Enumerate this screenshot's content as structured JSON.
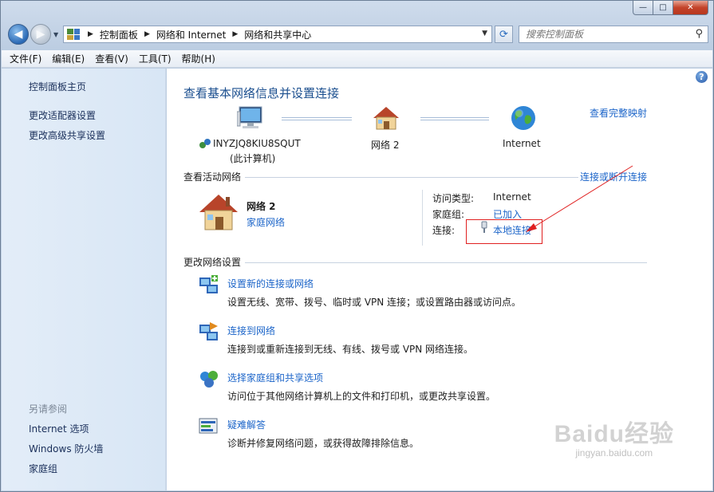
{
  "window": {
    "minimize_glyph": "—",
    "maximize_glyph": "□",
    "close_glyph": "✕"
  },
  "nav": {
    "back_glyph": "◀",
    "forward_glyph": "▶",
    "breadcrumbs": [
      "控制面板",
      "网络和 Internet",
      "网络和共享中心"
    ],
    "search_placeholder": "搜索控制面板"
  },
  "menu": [
    "文件(F)",
    "编辑(E)",
    "查看(V)",
    "工具(T)",
    "帮助(H)"
  ],
  "sidebar": {
    "top_links": [
      "控制面板主页",
      "更改适配器设置",
      "更改高级共享设置"
    ],
    "see_also_heading": "另请参阅",
    "see_also_links": [
      "Internet 选项",
      "Windows 防火墙",
      "家庭组"
    ]
  },
  "main": {
    "title": "查看基本网络信息并设置连接",
    "full_map_link": "查看完整映射",
    "map": {
      "computer_name": "INYZJQ8KIU8SQUT",
      "computer_sub": "(此计算机)",
      "network_name": "网络  2",
      "internet_label": "Internet"
    },
    "active_networks": {
      "heading": "查看活动网络",
      "connect_link": "连接或断开连接",
      "network_name": "网络  2",
      "network_type": "家庭网络",
      "access_type_label": "访问类型:",
      "access_type_value": "Internet",
      "homegroup_label": "家庭组:",
      "homegroup_value": "已加入",
      "connections_label": "连接:",
      "connections_value": "本地连接"
    },
    "change_settings": {
      "heading": "更改网络设置",
      "tasks": [
        {
          "title": "设置新的连接或网络",
          "desc": "设置无线、宽带、拨号、临时或 VPN 连接；或设置路由器或访问点。"
        },
        {
          "title": "连接到网络",
          "desc": "连接到或重新连接到无线、有线、拨号或 VPN 网络连接。"
        },
        {
          "title": "选择家庭组和共享选项",
          "desc": "访问位于其他网络计算机上的文件和打印机，或更改共享设置。"
        },
        {
          "title": "疑难解答",
          "desc": "诊断并修复网络问题，或获得故障排除信息。"
        }
      ]
    },
    "help_glyph": "?"
  },
  "watermark": {
    "main": "Baidu经验",
    "sub": "jingyan.baidu.com"
  },
  "colors": {
    "link": "#1c65c9",
    "title": "#1b4f8f",
    "annotation_red": "#e02020"
  }
}
